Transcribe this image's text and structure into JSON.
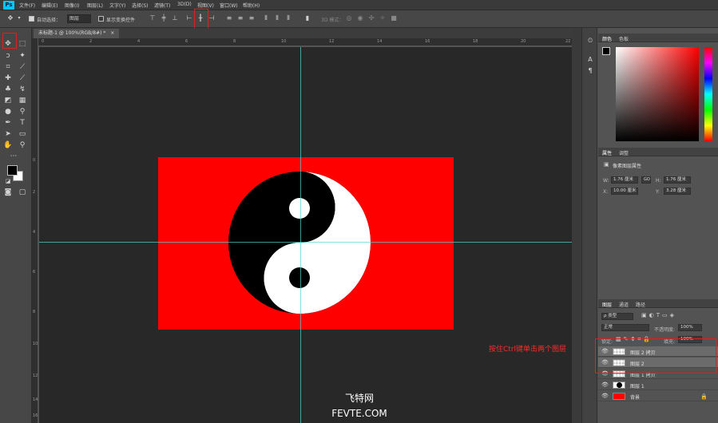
{
  "menubar": {
    "logo": "Ps",
    "items": [
      "文件(F)",
      "编辑(E)",
      "图像(I)",
      "图层(L)",
      "文字(Y)",
      "选择(S)",
      "滤镜(T)",
      "3D(D)",
      "视图(V)",
      "窗口(W)",
      "帮助(H)"
    ]
  },
  "options": {
    "auto_select_label": "自动选择：",
    "auto_select_value": "图层",
    "show_transform_label": "显示变换控件",
    "mode_3d_label": "3D 模式："
  },
  "document": {
    "tab_label": "未标题-1 @ 100%(RGB/8#) *",
    "tab_close": "×",
    "canvas_color": "#ff0000"
  },
  "ruler": {
    "top_ticks": [
      "0",
      "2",
      "4",
      "6",
      "8",
      "10",
      "12",
      "14",
      "16",
      "18",
      "20",
      "22"
    ],
    "left_ticks": [
      "0",
      "2",
      "4",
      "6",
      "8",
      "10",
      "12",
      "14",
      "16"
    ]
  },
  "watermark": {
    "line1": "飞特网",
    "line2": "FEVTE.COM"
  },
  "color_panel": {
    "tabs": [
      "颜色",
      "色板"
    ]
  },
  "properties_panel": {
    "tabs": [
      "属性",
      "调整"
    ],
    "title": "像素图层属性",
    "w_label": "W:",
    "w_value": "1.76 厘米",
    "h_label": "H:",
    "h_value": "1.76 厘米",
    "x_label": "X:",
    "x_value": "10.00 厘米",
    "y_label": "Y:",
    "y_value": "3.28 厘米",
    "link_label": "GO"
  },
  "layers_panel": {
    "tabs": [
      "图层",
      "通道",
      "路径"
    ],
    "filter_label": "ρ 类型",
    "blend_mode": "正常",
    "opacity_label": "不透明度:",
    "opacity_value": "100%",
    "lock_label": "锁定:",
    "fill_label": "填充:",
    "fill_value": "100%",
    "layers": [
      {
        "name": "图层 2 拷贝",
        "selected": true
      },
      {
        "name": "图层 2",
        "selected": true
      },
      {
        "name": "图层 1 拷贝",
        "selected": false
      },
      {
        "name": "图层 1",
        "selected": false
      },
      {
        "name": "背景",
        "selected": false
      }
    ]
  },
  "annotation": {
    "text": "按住Ctrl键单击两个图层",
    "color": "#ff2a2a"
  }
}
